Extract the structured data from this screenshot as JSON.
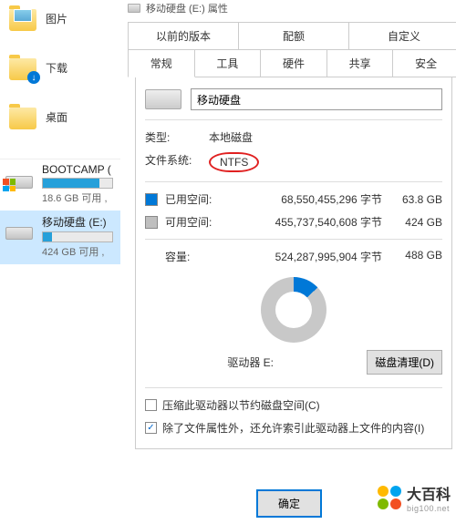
{
  "nav": {
    "pictures": "图片",
    "downloads": "下载",
    "desktop": "桌面"
  },
  "drives": [
    {
      "name": "BOOTCAMP (",
      "sub": "18.6 GB 可用 ,",
      "fill_pct": 82
    },
    {
      "name": "移动硬盘 (E:)",
      "sub": "424 GB 可用 ,",
      "fill_pct": 13
    }
  ],
  "dialog": {
    "title": "移动硬盘 (E:) 属性",
    "tabs_top": [
      "以前的版本",
      "配额",
      "自定义"
    ],
    "tabs_bottom": [
      "常规",
      "工具",
      "硬件",
      "共享",
      "安全"
    ],
    "name_value": "移动硬盘",
    "type_label": "类型:",
    "type_value": "本地磁盘",
    "fs_label": "文件系统:",
    "fs_value": "NTFS",
    "used_label": "已用空间:",
    "used_bytes": "68,550,455,296 字节",
    "used_hr": "63.8 GB",
    "free_label": "可用空间:",
    "free_bytes": "455,737,540,608 字节",
    "free_hr": "424 GB",
    "cap_label": "容量:",
    "cap_bytes": "524,287,995,904 字节",
    "cap_hr": "488 GB",
    "drive_letter": "驱动器 E:",
    "clean_btn": "磁盘清理(D)",
    "compress_label": "压缩此驱动器以节约磁盘空间(C)",
    "index_label": "除了文件属性外，还允许索引此驱动器上文件的内容(I)",
    "ok_btn": "确定"
  },
  "watermark": {
    "title": "大百科",
    "sub": "big100.net"
  },
  "chart_data": {
    "type": "pie",
    "title": "驱动器 E:",
    "categories": [
      "已用空间",
      "可用空间"
    ],
    "values": [
      68550455296,
      455737540608
    ],
    "series_colors": [
      "#0078d7",
      "#c8c8c8"
    ]
  }
}
